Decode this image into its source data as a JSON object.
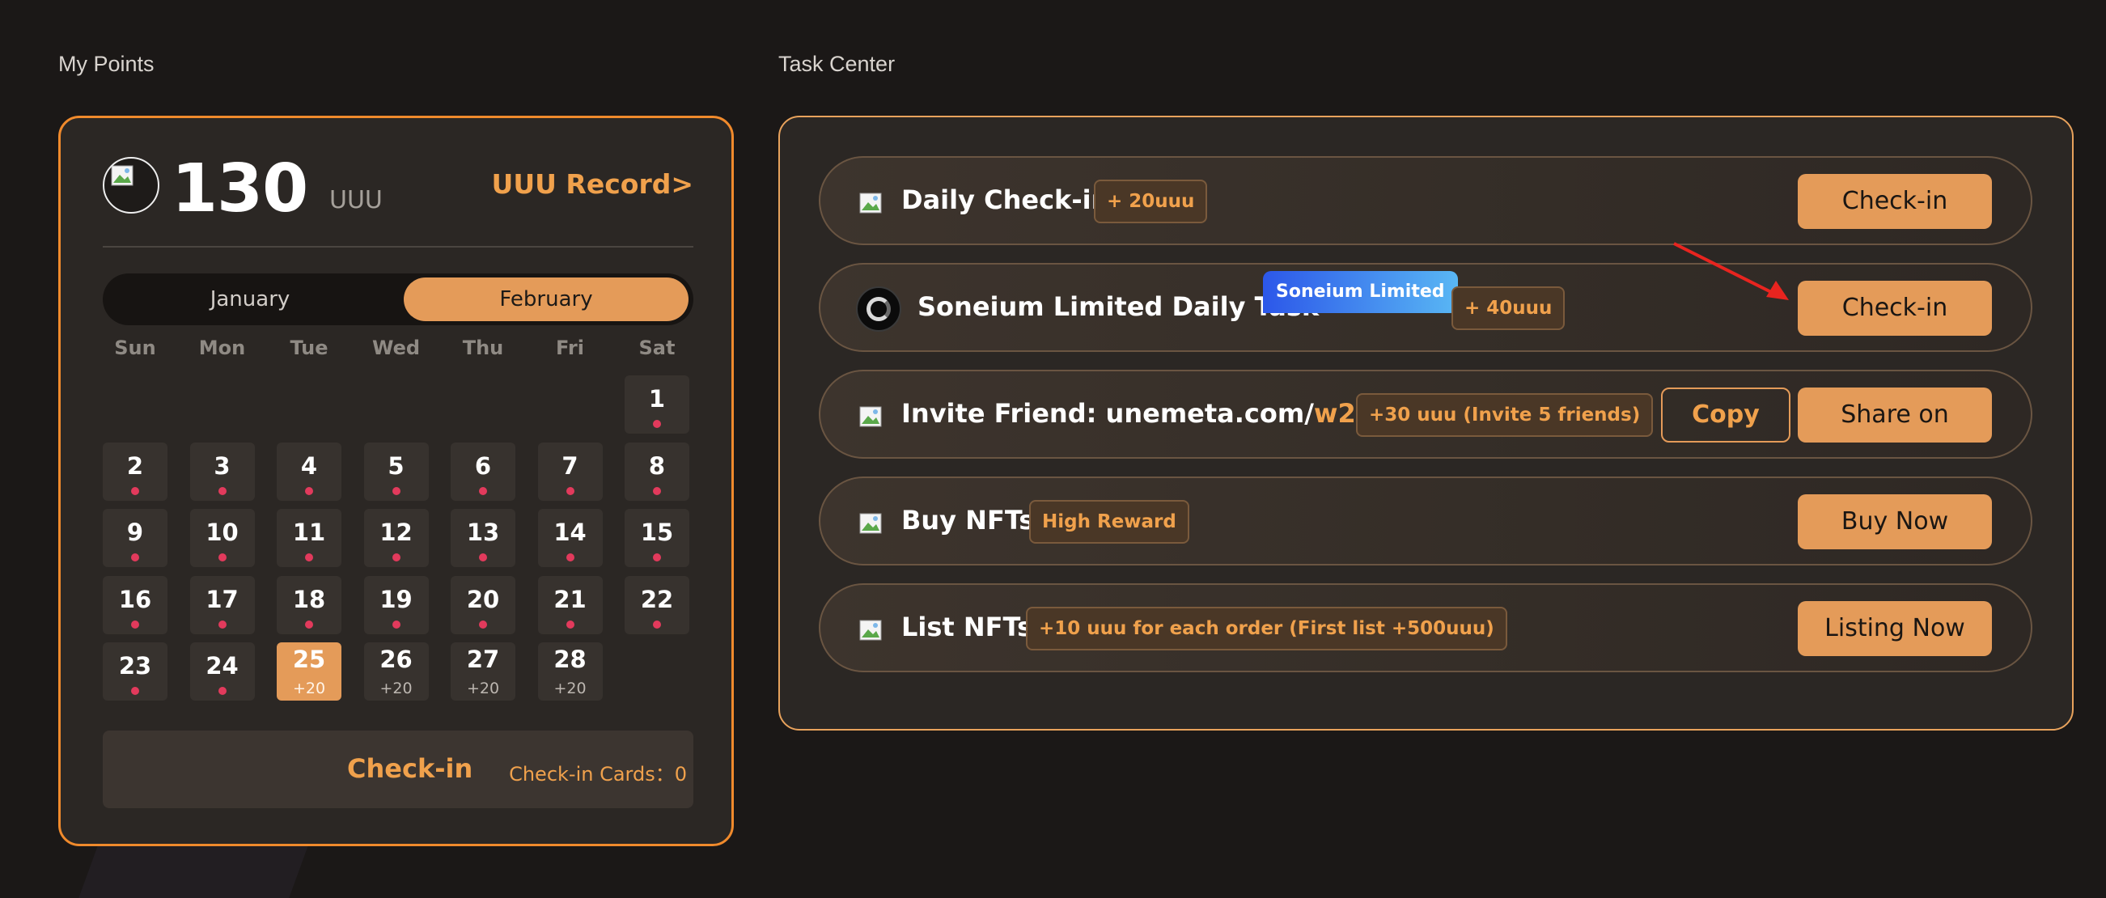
{
  "sections": {
    "points_title": "My Points",
    "tasks_title": "Task Center"
  },
  "points": {
    "value": "130",
    "unit": "UUU",
    "record_link": "UUU Record>"
  },
  "calendar": {
    "months": [
      "January",
      "February"
    ],
    "selected_month": "February",
    "weekdays": [
      "Sun",
      "Mon",
      "Tue",
      "Wed",
      "Thu",
      "Fri",
      "Sat"
    ],
    "first_weekday_index": 6,
    "today": 25,
    "days": [
      {
        "day": "1",
        "state": "checked"
      },
      {
        "day": "2",
        "state": "checked"
      },
      {
        "day": "3",
        "state": "checked"
      },
      {
        "day": "4",
        "state": "checked"
      },
      {
        "day": "5",
        "state": "checked"
      },
      {
        "day": "6",
        "state": "checked"
      },
      {
        "day": "7",
        "state": "checked"
      },
      {
        "day": "8",
        "state": "checked"
      },
      {
        "day": "9",
        "state": "checked"
      },
      {
        "day": "10",
        "state": "checked"
      },
      {
        "day": "11",
        "state": "checked"
      },
      {
        "day": "12",
        "state": "checked"
      },
      {
        "day": "13",
        "state": "checked"
      },
      {
        "day": "14",
        "state": "checked"
      },
      {
        "day": "15",
        "state": "checked"
      },
      {
        "day": "16",
        "state": "checked"
      },
      {
        "day": "17",
        "state": "checked"
      },
      {
        "day": "18",
        "state": "checked"
      },
      {
        "day": "19",
        "state": "checked"
      },
      {
        "day": "20",
        "state": "checked"
      },
      {
        "day": "21",
        "state": "checked"
      },
      {
        "day": "22",
        "state": "checked"
      },
      {
        "day": "23",
        "state": "checked"
      },
      {
        "day": "24",
        "state": "checked"
      },
      {
        "day": "25",
        "state": "today",
        "bonus": "+20"
      },
      {
        "day": "26",
        "state": "future",
        "bonus": "+20"
      },
      {
        "day": "27",
        "state": "future",
        "bonus": "+20"
      },
      {
        "day": "28",
        "state": "future",
        "bonus": "+20"
      }
    ],
    "checkin_label": "Check-in",
    "checkin_cards": "Check-in Cards：0"
  },
  "tasks": [
    {
      "title": "Daily Check-in",
      "reward": "+ 20uuu",
      "action": "Check-in"
    },
    {
      "title": "Soneium Limited Daily Task",
      "tag": "Soneium Limited",
      "reward": "+ 40uuu",
      "action": "Check-in"
    },
    {
      "title": "Invite Friend: unemeta.com/",
      "title_accent": "w2cu83",
      "reward": "+30 uuu (Invite 5 friends)",
      "secondary_action": "Copy",
      "action": "Share on"
    },
    {
      "title": "Buy NFTs",
      "reward": "High Reward",
      "action": "Buy Now"
    },
    {
      "title": "List NFTs",
      "reward": "+10 uuu for each order (First list +500uuu)",
      "action": "Listing Now"
    }
  ],
  "colors": {
    "accent": "#e49b59",
    "accent_text": "#f0a14c",
    "checked_dot": "#e23a5c",
    "background": "#1b1817"
  },
  "icons": {
    "avatar": "broken-image-icon",
    "task_icon": "broken-image-icon",
    "soneium": "soneium-logo-icon",
    "annotation": "red-arrow-icon"
  }
}
